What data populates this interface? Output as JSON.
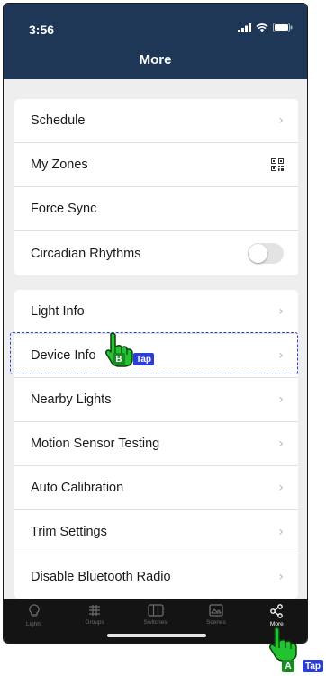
{
  "status_bar": {
    "time": "3:56"
  },
  "nav": {
    "title": "More"
  },
  "groups": [
    {
      "items": [
        {
          "label": "Schedule",
          "accessory": "chevron"
        },
        {
          "label": "My Zones",
          "accessory": "qr-code"
        },
        {
          "label": "Force Sync",
          "accessory": "none"
        },
        {
          "label": "Circadian Rhythms",
          "accessory": "toggle",
          "toggle_on": false
        }
      ]
    },
    {
      "items": [
        {
          "label": "Light Info",
          "accessory": "chevron"
        },
        {
          "label": "Device Info",
          "accessory": "chevron"
        },
        {
          "label": "Nearby Lights",
          "accessory": "chevron"
        },
        {
          "label": "Motion Sensor Testing",
          "accessory": "chevron"
        },
        {
          "label": "Auto Calibration",
          "accessory": "chevron"
        },
        {
          "label": "Trim Settings",
          "accessory": "chevron"
        },
        {
          "label": "Disable Bluetooth Radio",
          "accessory": "chevron"
        }
      ]
    }
  ],
  "tabs": [
    {
      "label": "Lights",
      "icon": "bulb-icon",
      "active": false
    },
    {
      "label": "Groups",
      "icon": "groups-icon",
      "active": false
    },
    {
      "label": "Switches",
      "icon": "switches-icon",
      "active": false
    },
    {
      "label": "Scenes",
      "icon": "scenes-icon",
      "active": false
    },
    {
      "label": "More",
      "icon": "share-icon",
      "active": true
    }
  ],
  "annotations": {
    "a_letter": "A",
    "a_action": "Tap",
    "b_letter": "B",
    "b_action": "Tap"
  },
  "colors": {
    "header": "#1f3757",
    "highlight": "#2b3fd6",
    "hand": "#22c32e",
    "tabbar": "#141414"
  }
}
